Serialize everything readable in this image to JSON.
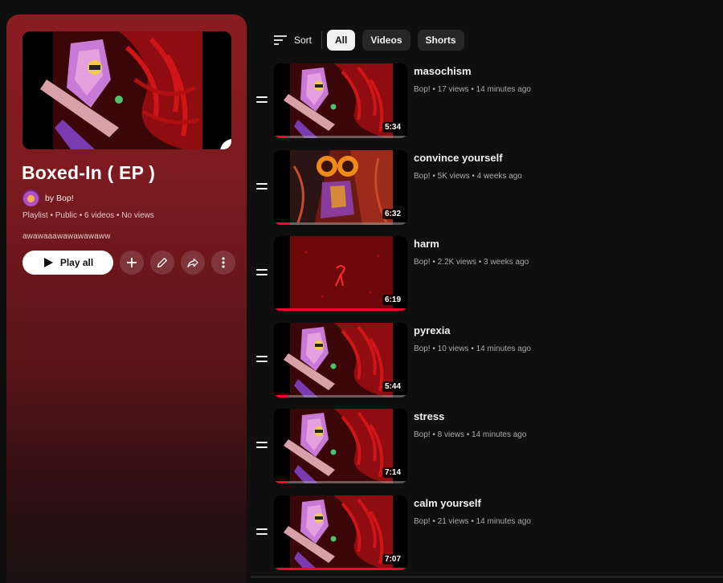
{
  "playlist": {
    "title": "Boxed-In ( EP )",
    "owner": "by Bop!",
    "meta": "Playlist • Public • 6 videos • No views",
    "description": "awawaaawawawawaww",
    "play_all_label": "Play all"
  },
  "filters": {
    "sort_label": "Sort",
    "chips": [
      "All",
      "Videos",
      "Shorts"
    ],
    "active": "All"
  },
  "videos": [
    {
      "title": "masochism",
      "meta": "Bop! • 17 views • 14 minutes ago",
      "duration": "5:34",
      "progress": 0.1,
      "art": "cat"
    },
    {
      "title": "convince yourself",
      "meta": "Bop! • 5K views • 4 weeks ago",
      "duration": "6:32",
      "progress": 0.12,
      "art": "eyes"
    },
    {
      "title": "harm",
      "meta": "Bop! • 2.2K views • 3 weeks ago",
      "duration": "6:19",
      "progress": 1.0,
      "art": "red"
    },
    {
      "title": "pyrexia",
      "meta": "Bop! • 10 views • 14 minutes ago",
      "duration": "5:44",
      "progress": 0.1,
      "art": "cat"
    },
    {
      "title": "stress",
      "meta": "Bop! • 8 views • 14 minutes ago",
      "duration": "7:14",
      "progress": 0.1,
      "art": "cat"
    },
    {
      "title": "calm yourself",
      "meta": "Bop! • 21 views • 14 minutes ago",
      "duration": "7:07",
      "progress": 1.0,
      "art": "cat"
    }
  ],
  "colors": {
    "accent": "#ff0033",
    "panel": "#8a1c22"
  }
}
